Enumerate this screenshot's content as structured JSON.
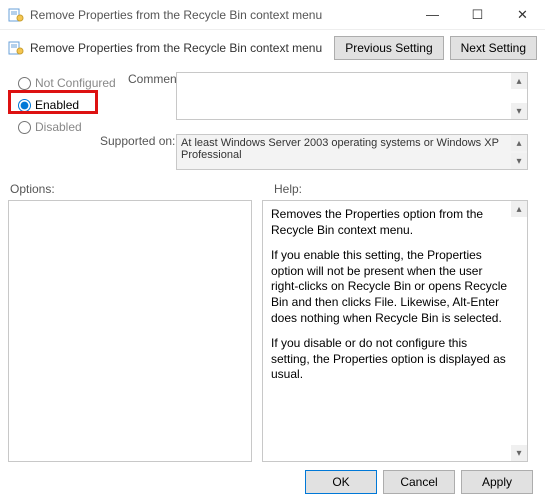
{
  "window": {
    "title": "Remove Properties from the Recycle Bin context menu",
    "minimize": "—",
    "maximize": "☐",
    "close": "✕"
  },
  "header": {
    "title": "Remove Properties from the Recycle Bin context menu"
  },
  "nav": {
    "previous": "Previous Setting",
    "next": "Next Setting"
  },
  "radios": {
    "not_configured": "Not Configured",
    "enabled": "Enabled",
    "disabled": "Disabled",
    "selected": "enabled"
  },
  "labels": {
    "comment": "Comment:",
    "supported": "Supported on:",
    "options": "Options:",
    "help": "Help:"
  },
  "comment_value": "",
  "supported_on": "At least Windows Server 2003 operating systems or Windows XP Professional",
  "help": {
    "p1": "Removes the Properties option from the Recycle Bin context menu.",
    "p2": "If you enable this setting, the Properties option will not be present when the user right-clicks on Recycle Bin or opens Recycle Bin and then clicks File. Likewise, Alt-Enter does nothing when Recycle Bin is selected.",
    "p3": "If you disable or do not configure this setting, the Properties option is displayed as usual."
  },
  "footer": {
    "ok": "OK",
    "cancel": "Cancel",
    "apply": "Apply"
  }
}
